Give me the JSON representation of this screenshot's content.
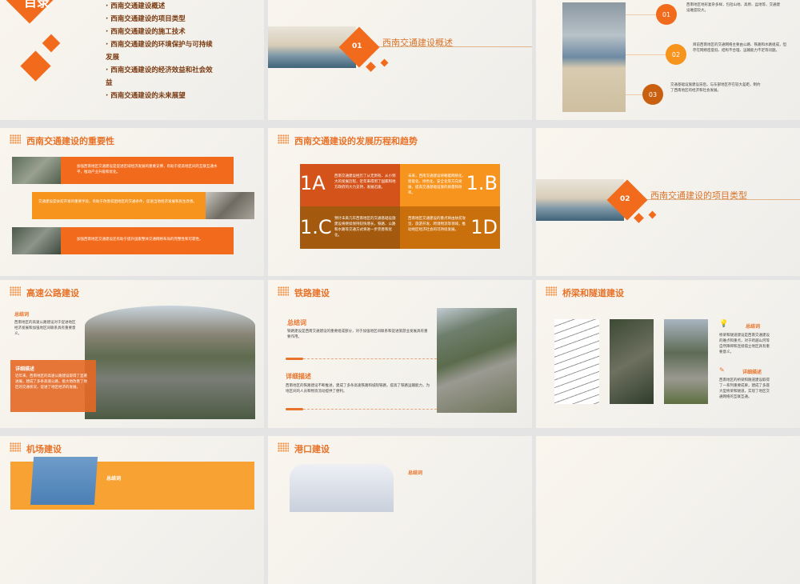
{
  "toc": {
    "title": "目录",
    "items": [
      "西南交通建设概述",
      "西南交通建设的项目类型",
      "西南交通建设的施工技术",
      "西南交通建设的环境保护与可持续发展",
      "西南交通建设的经济效益和社会效益",
      "西南交通建设的未来展望"
    ]
  },
  "section1": {
    "number": "01",
    "title": "西南交通建设概述"
  },
  "overview": {
    "points": [
      {
        "num": "01",
        "text": "西南地区地形复杂多样，包括山地、高原、盆地等，交通建设难度较大。"
      },
      {
        "num": "02",
        "text": "目前西南地区的交通网络主要由公路、铁路和水路组成，但存在网络密度低、结构不合理、运输能力不足等问题。"
      },
      {
        "num": "03",
        "text": "交通基础设施建设滞后，与东部地区存在较大差距，制约了西南地区的经济和社会发展。"
      }
    ]
  },
  "importance": {
    "title": "西南交通建设的重要性",
    "rows": [
      "加强西南地区交通建设是促进区域经济发展的重要支撑，有助于提高地区间的互联互通水平，推动产业升级和优化。",
      "交通建设是扶贫开发的重要手段，有助于改善贫困地区的交通条件，促进当地经济发展和民生改善。",
      "加强西南地区交通建设还有助于提升国家整体交通网络布局的完整性和可靠性。"
    ]
  },
  "history": {
    "title": "西南交通建设的发展历程和趋势",
    "cells": [
      {
        "label": "1A",
        "text": "西南交通建设经历了从无到有、从小到大的发展历程，近年来得到了国家和地方政府的大力支持，发展迅速。"
      },
      {
        "label": "1.B",
        "text": "未来，西南交通建设将朝着网络化、智能化、绿色化、安全化等方向发展，提高交通基础设施的质量和效率。"
      },
      {
        "label": "1.C",
        "text": "预计未来几年西南地区的交通基础设施建设将继续保持较快增长，铁路、公路和水路等交通方式将进一步完善和优化。"
      },
      {
        "label": "1D",
        "text": "西南地区交通建设的重点将由扶贫攻坚、旅游开发、跨境物流等领域，推动地区经济社会的可持续发展。"
      }
    ]
  },
  "section2": {
    "number": "02",
    "title": "西南交通建设的项目类型"
  },
  "highway": {
    "title": "高速公路建设",
    "summary_label": "总结词",
    "summary": "西南地区的高速公路建设对于促进地区经济发展和加强地区间联系具有重要意义。",
    "detail_label": "详细描述",
    "detail": "近年来，西南地区的高速公路建设取得了显著进展，建成了多条高速公路，极大地改善了地区的交通状况，促进了地区经济的发展。"
  },
  "railway": {
    "title": "铁路建设",
    "summary_label": "总结词",
    "summary": "铁路建设是西南交通建设的重要组成部分，对于加强地区间联系和促进旅游业发展具有重要作用。",
    "detail_label": "详细描述",
    "detail": "西南地区的铁路建设不断推进，建成了多条高速铁路和城际铁路，提高了铁路运输能力，为地区间的人员和物资流动提供了便利。"
  },
  "bridge": {
    "title": "桥梁和隧道建设",
    "summary_label": "总结词",
    "summary": "桥梁和隧道建设是西南交通建设的难点和重点，对于跨越山河等自然障碍和连接孤立地区具有重要意义。",
    "detail_label": "详细描述",
    "detail": "西南地区的桥梁和隧道建设取得了一系列重要成果，建成了多座大型桥梁和隧道，实现了地区交通网络的互联互通。"
  },
  "airport": {
    "title": "机场建设",
    "summary_label": "总结词"
  },
  "port": {
    "title": "港口建设",
    "summary_label": "总结词"
  },
  "colors": {
    "orange": "#f26b1d",
    "amber": "#f7941d",
    "brown": "#7a3a10"
  }
}
